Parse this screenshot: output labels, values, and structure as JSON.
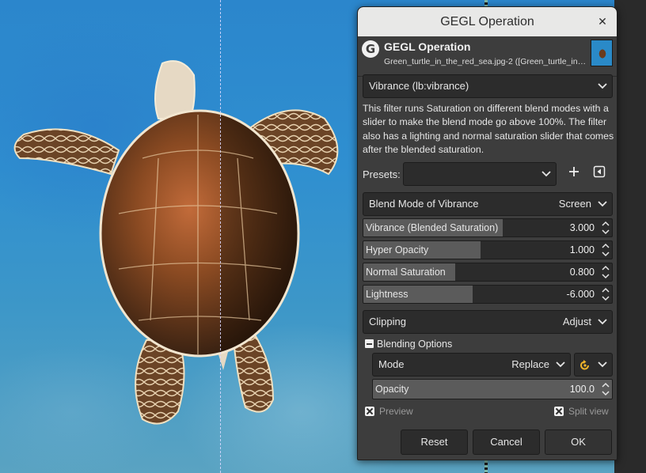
{
  "dialog": {
    "window_title": "GEGL Operation",
    "header_title": "GEGL Operation",
    "header_subtitle": "Green_turtle_in_the_red_sea.jpg-2 ([Green_turtle_in…",
    "operation": "Vibrance (lb:vibrance)",
    "description": "This filter runs Saturation on different blend modes with a slider to make the blend mode go above 100%. The filter also has a lighting and normal saturation slider that comes after the blended saturation.",
    "presets_label": "Presets:",
    "presets_value": "",
    "blend_mode": {
      "label": "Blend Mode of Vibrance",
      "value": "Screen"
    },
    "sliders": [
      {
        "label": "Vibrance (Blended Saturation)",
        "value": "3.000",
        "fill": 0.56
      },
      {
        "label": "Hyper Opacity",
        "value": "1.000",
        "fill": 0.47
      },
      {
        "label": "Normal Saturation",
        "value": "0.800",
        "fill": 0.37
      },
      {
        "label": "Lightness",
        "value": "-6.000",
        "fill": 0.44
      }
    ],
    "clipping": {
      "label": "Clipping",
      "value": "Adjust"
    },
    "blending": {
      "header": "Blending Options",
      "mode_label": "Mode",
      "mode_value": "Replace",
      "opacity_label": "Opacity",
      "opacity_value": "100.0",
      "opacity_fill": 1.0
    },
    "preview_label": "Preview",
    "split_view_label": "Split view",
    "buttons": {
      "reset": "Reset",
      "cancel": "Cancel",
      "ok": "OK"
    }
  },
  "colors": {
    "dialog_bg": "#3d3d3d",
    "titlebar_bg": "#e8e8e7",
    "reset_icon": "#f0b429"
  }
}
